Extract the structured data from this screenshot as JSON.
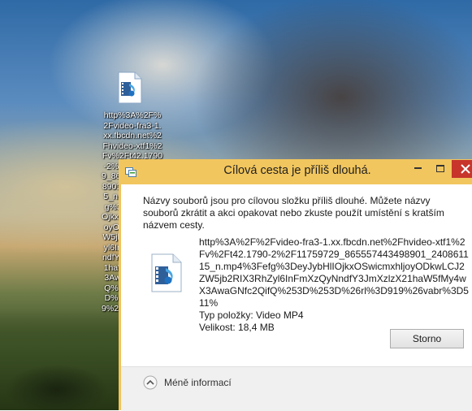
{
  "desktop": {
    "icon_label": "http%3A%2F%2Fvideo-fra3-1.xx.fbcdn.net%2Fhvideo-xtf1%2Fv%2Ft42.1790-2%2F11759729_865557443498901_240861115_n.mp4%3Fefg%3DeyJybHlIOjkxOSwicmxhljoyODkwLCJ2ZW5jb2RIX3RhZyl6InFmXzQyNndfY3JmXzlzX21haW5fMy4wX3AwaGNfc2QifQ%253D%253D%26rl%3D919%26vabr%3D511%"
  },
  "dialog": {
    "title": "Cílová cesta je příliš dlouhá.",
    "message": "Názvy souborů jsou pro cílovou složku příliš dlouhé. Můžete názvy souborů zkrátit a akci opakovat nebo zkuste použít umístění s kratším názvem cesty.",
    "file": {
      "name": "http%3A%2F%2Fvideo-fra3-1.xx.fbcdn.net%2Fhvideo-xtf1%2Fv%2Ft42.1790-2%2F11759729_865557443498901_240861115_n.mp4%3Fefg%3DeyJybHlIOjkxOSwicmxhljoyODkwLCJ2ZW5jb2RIX3RhZyl6InFmXzQyNndfY3JmXzlzX21haW5fMy4wX3AwaGNfc2QifQ%253D%253D%26rl%3D919%26vabr%3D511%",
      "type": "Typ položky: Video MP4",
      "size": "Velikost: 18,4 MB"
    },
    "cancel_label": "Storno",
    "less_info_label": "Méně informací",
    "colors": {
      "title_bar": "#f2c65e",
      "close_button": "#c7352b",
      "content_background": "#ffffff",
      "footer_background": "#f0f0f0"
    },
    "icons": [
      "video-file-icon",
      "minimize-icon",
      "maximize-icon",
      "close-icon",
      "chevron-up-icon"
    ]
  }
}
